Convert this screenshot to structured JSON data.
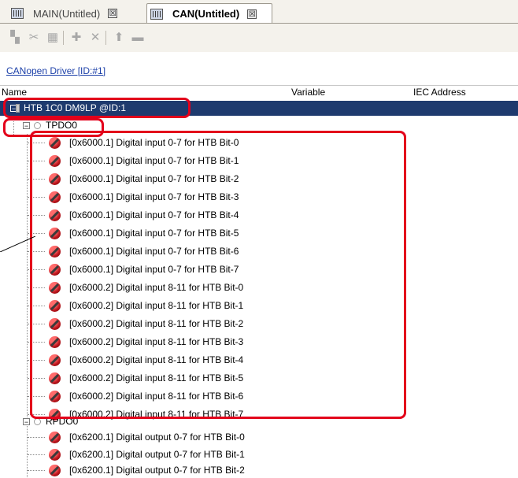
{
  "tabs": [
    {
      "label": "MAIN(Untitled)",
      "active": false,
      "close": "☒"
    },
    {
      "label": "CAN(Untitled)",
      "active": true,
      "close": "☒"
    }
  ],
  "toolbar": {
    "buttons": [
      "stack-icon",
      "cut-icon",
      "paste-icon",
      "configure-icon",
      "delete-icon",
      "move-up-icon",
      "move-down-icon"
    ]
  },
  "driver_link": "CANopen Driver [ID:#1]",
  "columns": {
    "name": "Name",
    "variable": "Variable",
    "iec_address": "IEC Address"
  },
  "device": {
    "label": "HTB 1C0 DM9LP @ID:1",
    "expander": "−"
  },
  "tpdo": {
    "label": "TPDO0",
    "expander": "−",
    "items": [
      "[0x6000.1] Digital input 0-7 for HTB Bit-0",
      "[0x6000.1] Digital input 0-7 for HTB Bit-1",
      "[0x6000.1] Digital input 0-7 for HTB Bit-2",
      "[0x6000.1] Digital input 0-7 for HTB Bit-3",
      "[0x6000.1] Digital input 0-7 for HTB Bit-4",
      "[0x6000.1] Digital input 0-7 for HTB Bit-5",
      "[0x6000.1] Digital input 0-7 for HTB Bit-6",
      "[0x6000.1] Digital input 0-7 for HTB Bit-7",
      "[0x6000.2] Digital input 8-11 for HTB Bit-0",
      "[0x6000.2] Digital input 8-11 for HTB Bit-1",
      "[0x6000.2] Digital input 8-11 for HTB Bit-2",
      "[0x6000.2] Digital input 8-11 for HTB Bit-3",
      "[0x6000.2] Digital input 8-11 for HTB Bit-4",
      "[0x6000.2] Digital input 8-11 for HTB Bit-5",
      "[0x6000.2] Digital input 8-11 for HTB Bit-6",
      "[0x6000.2] Digital input 8-11 for HTB Bit-7"
    ]
  },
  "rpdo": {
    "label": "RPDO0",
    "expander": "−",
    "items": [
      "[0x6200.1] Digital output 0-7 for HTB Bit-0",
      "[0x6200.1] Digital output 0-7 for HTB Bit-1",
      "[0x6200.1] Digital output 0-7 for HTB Bit-2"
    ]
  },
  "colors": {
    "selection": "#1e3a6e",
    "highlight": "#e3001b",
    "link": "#1b3fa8"
  }
}
